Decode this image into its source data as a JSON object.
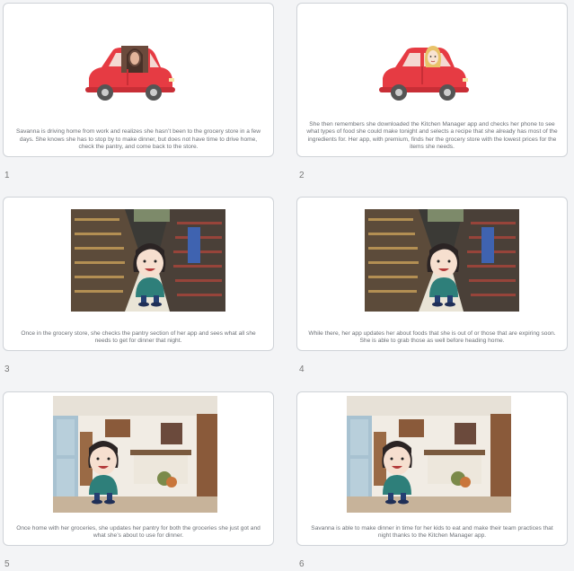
{
  "slides": [
    {
      "number": "1",
      "caption": "Savanna is driving home from work and realizes she hasn’t been to the grocery store in a few days. She knows she has to stop by to make dinner, but does not have time to drive home, check the pantry, and come back to the store.",
      "scene": "car-with-photo-driver"
    },
    {
      "number": "2",
      "caption": "She then remembers she downloaded the Kitchen Manager app and checks her phone to see what types of food she could make tonight and selects a recipe that she already has most of the ingredients for. Her app, with premium, finds her the grocery store with the lowest prices for the items she needs.",
      "scene": "car-with-cartoon-driver"
    },
    {
      "number": "3",
      "caption": "Once in the grocery store, she checks the pantry section of her app and sees what all she needs to get for dinner that night.",
      "scene": "grocery-aisle-with-character"
    },
    {
      "number": "4",
      "caption": "While there, her app updates her about foods that she is out of or those that are expiring soon. She is able to grab those as well before heading home.",
      "scene": "grocery-aisle-with-character"
    },
    {
      "number": "5",
      "caption": "Once home with her groceries, she updates her pantry for both the groceries she just got and what she’s about to use for dinner.",
      "scene": "kitchen-with-character"
    },
    {
      "number": "6",
      "caption": "Savanna is able to make dinner in time for her kids to eat and make their team practices that night thanks to the Kitchen Manager app.",
      "scene": "kitchen-with-character"
    }
  ],
  "colors": {
    "car": "#e63b43",
    "character_shirt": "#2e7f7a",
    "aisle_floor": "#e9e4d6",
    "kitchen_cabinet": "#a8c2d1"
  }
}
